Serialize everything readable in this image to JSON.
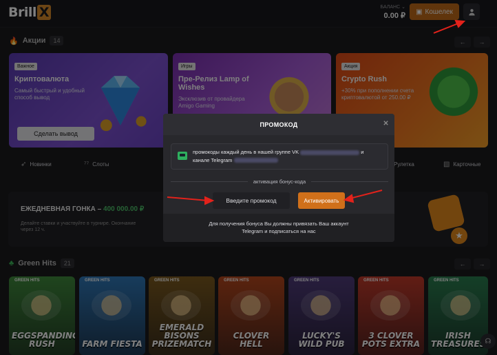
{
  "header": {
    "logo_text": "Brill",
    "logo_mark": "X",
    "balance_label": "БАЛАНС",
    "balance_value": "0.00 ₽",
    "wallet_label": "Кошелек",
    "wallet_icon": "wallet-icon",
    "profile_icon": "user-icon"
  },
  "promotions": {
    "title": "Акции",
    "count": "14",
    "cards": [
      {
        "tag": "Важное",
        "title": "Криптовалюта",
        "desc": "Самый быстрый и удобный способ вывод",
        "button": "Сделать вывод"
      },
      {
        "tag": "Игры",
        "title": "Пре-Релиз Lamp of Wishes",
        "desc": "Эксклюзив от провайдера Amigo Gaming"
      },
      {
        "tag": "Акция",
        "title": "Crypto Rush",
        "desc": "+30% при пополнении счета криптовалютой от 250.00 ₽"
      }
    ]
  },
  "categories": [
    {
      "label": "Новинки",
      "icon": "rocket-icon"
    },
    {
      "label": "Слоты",
      "icon": "slot-777-icon"
    },
    {
      "label": "Рулетка",
      "icon": "roulette-icon"
    },
    {
      "label": "Карточные",
      "icon": "cards-icon"
    }
  ],
  "race": {
    "title_prefix": "ЕЖЕДНЕВНАЯ ГОНКА – ",
    "amount": "400 000.00 ₽",
    "desc": "Делайте ставки и участвуйте в турнире. Окончание через 12 ч."
  },
  "green_hits": {
    "title": "Green Hits",
    "count": "21",
    "badge": "GREEN HITS",
    "games": [
      {
        "name": "EGGSPANDING RUSH",
        "color": "#3f8a3c"
      },
      {
        "name": "FARM FIESTA",
        "color": "#2f78b8"
      },
      {
        "name": "EMERALD BISONS PRIZEMATCH",
        "color": "#7c5a1f"
      },
      {
        "name": "CLOVER HELL",
        "color": "#b5471d"
      },
      {
        "name": "LUCKY'S WILD PUB",
        "color": "#4f3b7a"
      },
      {
        "name": "3 CLOVER POTS EXTRA",
        "color": "#c23a2a"
      },
      {
        "name": "IRISH TREASURES",
        "color": "#2a7e4f"
      }
    ]
  },
  "promo_modal": {
    "title": "ПРОМОКОД",
    "info_part1": "промокоды каждый день в нашей группе VK",
    "info_and": "и",
    "info_part2": "канале Telegram",
    "divider_text": "активация бонус-кода",
    "code_placeholder": "Введите промокод",
    "activate_label": "Активировать",
    "footer": "Для получения бонуса Вы должны привязать Ваш аккаунт Telegram и подписаться на нас"
  },
  "colors": {
    "accent": "#d0701a",
    "green": "#4ec46a",
    "annotation": "#e3221b"
  }
}
